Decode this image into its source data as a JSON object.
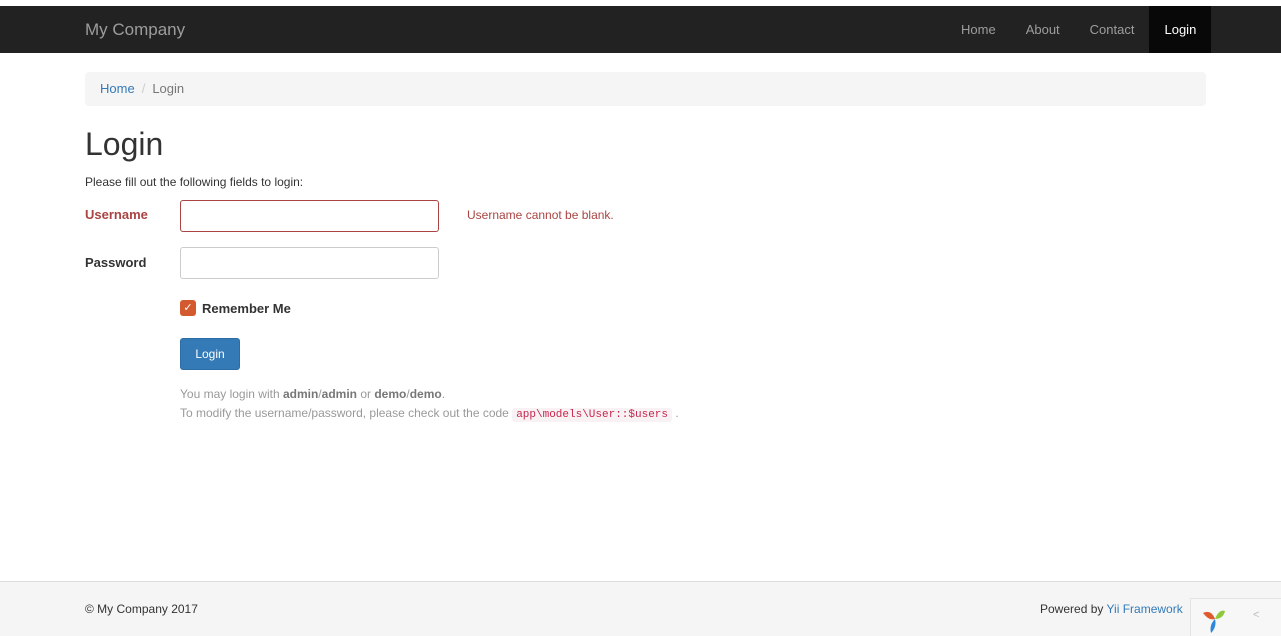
{
  "navbar": {
    "brand": "My Company",
    "items": [
      {
        "label": "Home",
        "active": false
      },
      {
        "label": "About",
        "active": false
      },
      {
        "label": "Contact",
        "active": false
      },
      {
        "label": "Login",
        "active": true
      }
    ]
  },
  "breadcrumb": {
    "home": "Home",
    "separator": "/",
    "current": "Login"
  },
  "page": {
    "title": "Login",
    "intro": "Please fill out the following fields to login:"
  },
  "form": {
    "username_label": "Username",
    "username_value": "",
    "username_error": "Username cannot be blank.",
    "password_label": "Password",
    "password_value": "",
    "remember_label": "Remember Me",
    "remember_checked": true,
    "submit_label": "Login"
  },
  "hint": {
    "line1_prefix": "You may login with ",
    "admin_user": "admin",
    "slash1": "/",
    "admin_pass": "admin",
    "or": " or ",
    "demo_user": "demo",
    "slash2": "/",
    "demo_pass": "demo",
    "line1_suffix": ".",
    "line2_prefix": "To modify the username/password, please check out the code ",
    "code": "app\\models\\User::$users",
    "line2_suffix": "."
  },
  "footer": {
    "copyright": "© My Company 2017",
    "powered_prefix": "Powered by ",
    "powered_link": "Yii Framework",
    "debug_toggle": "<"
  },
  "colors": {
    "navbar_bg": "#222222",
    "error": "#a94442",
    "primary": "#337ab7",
    "checkbox": "#d35a2e"
  },
  "icons": {
    "checkbox": "check-icon",
    "debug_logo": "yii-logo-icon"
  }
}
